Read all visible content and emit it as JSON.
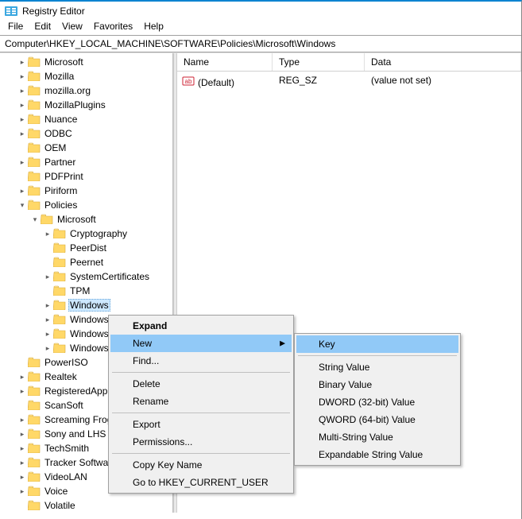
{
  "window": {
    "title": "Registry Editor"
  },
  "menu": {
    "file": "File",
    "edit": "Edit",
    "view": "View",
    "favorites": "Favorites",
    "help": "Help"
  },
  "address": "Computer\\HKEY_LOCAL_MACHINE\\SOFTWARE\\Policies\\Microsoft\\Windows",
  "list": {
    "headers": {
      "name": "Name",
      "type": "Type",
      "data": "Data"
    },
    "rows": [
      {
        "name": "(Default)",
        "type": "REG_SZ",
        "data": "(value not set)"
      }
    ]
  },
  "tree": [
    {
      "level": 1,
      "exp": ">",
      "label": "Microsoft"
    },
    {
      "level": 1,
      "exp": ">",
      "label": "Mozilla"
    },
    {
      "level": 1,
      "exp": ">",
      "label": "mozilla.org"
    },
    {
      "level": 1,
      "exp": ">",
      "label": "MozillaPlugins"
    },
    {
      "level": 1,
      "exp": ">",
      "label": "Nuance"
    },
    {
      "level": 1,
      "exp": ">",
      "label": "ODBC"
    },
    {
      "level": 1,
      "exp": "",
      "label": "OEM"
    },
    {
      "level": 1,
      "exp": ">",
      "label": "Partner"
    },
    {
      "level": 1,
      "exp": "",
      "label": "PDFPrint"
    },
    {
      "level": 1,
      "exp": ">",
      "label": "Piriform"
    },
    {
      "level": 1,
      "exp": "v",
      "label": "Policies"
    },
    {
      "level": 2,
      "exp": "v",
      "label": "Microsoft"
    },
    {
      "level": 3,
      "exp": ">",
      "label": "Cryptography"
    },
    {
      "level": 3,
      "exp": "",
      "label": "PeerDist"
    },
    {
      "level": 3,
      "exp": "",
      "label": "Peernet"
    },
    {
      "level": 3,
      "exp": ">",
      "label": "SystemCertificates"
    },
    {
      "level": 3,
      "exp": "",
      "label": "TPM"
    },
    {
      "level": 3,
      "exp": ">",
      "label": "Windows",
      "selected": true
    },
    {
      "level": 3,
      "exp": ">",
      "label": "Windows"
    },
    {
      "level": 3,
      "exp": ">",
      "label": "Windows"
    },
    {
      "level": 3,
      "exp": ">",
      "label": "Windows"
    },
    {
      "level": 1,
      "exp": "",
      "label": "PowerISO"
    },
    {
      "level": 1,
      "exp": ">",
      "label": "Realtek"
    },
    {
      "level": 1,
      "exp": ">",
      "label": "RegisteredAppli"
    },
    {
      "level": 1,
      "exp": "",
      "label": "ScanSoft"
    },
    {
      "level": 1,
      "exp": ">",
      "label": "Screaming Frog"
    },
    {
      "level": 1,
      "exp": ">",
      "label": "Sony and LHS"
    },
    {
      "level": 1,
      "exp": ">",
      "label": "TechSmith"
    },
    {
      "level": 1,
      "exp": ">",
      "label": "Tracker Softwar"
    },
    {
      "level": 1,
      "exp": ">",
      "label": "VideoLAN"
    },
    {
      "level": 1,
      "exp": ">",
      "label": "Voice"
    },
    {
      "level": 1,
      "exp": "",
      "label": "Volatile"
    }
  ],
  "ctx": {
    "expand": "Expand",
    "new": "New",
    "find": "Find...",
    "delete": "Delete",
    "rename": "Rename",
    "export": "Export",
    "permissions": "Permissions...",
    "copykey": "Copy Key Name",
    "gotohkcu": "Go to HKEY_CURRENT_USER"
  },
  "ctxsub": {
    "key": "Key",
    "string": "String Value",
    "binary": "Binary Value",
    "dword": "DWORD (32-bit) Value",
    "qword": "QWORD (64-bit) Value",
    "multi": "Multi-String Value",
    "expand": "Expandable String Value"
  }
}
